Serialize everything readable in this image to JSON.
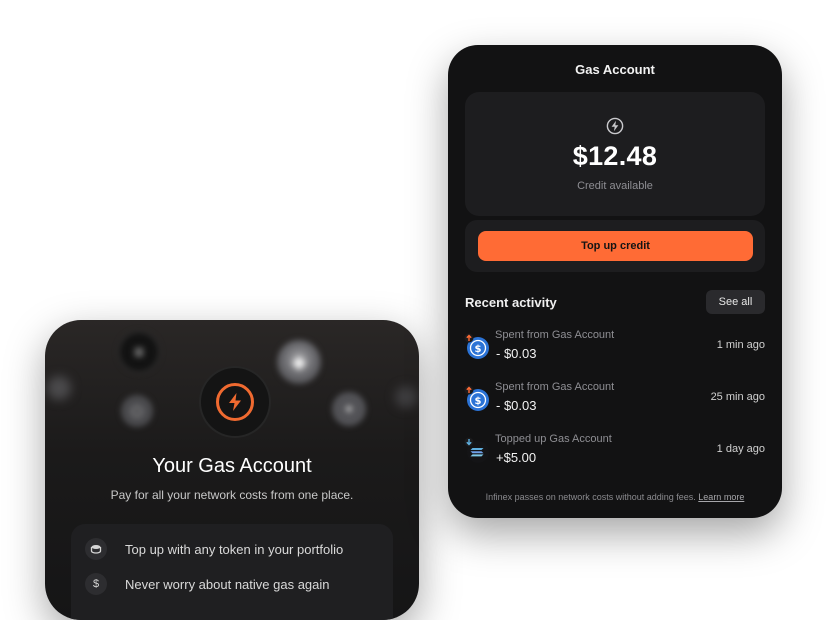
{
  "onboarding": {
    "title": "Your Gas Account",
    "subtitle": "Pay for all your network costs from one place.",
    "features": [
      {
        "icon": "coins-icon",
        "text": "Top up with any token in your portfolio"
      },
      {
        "icon": "dollar-icon",
        "text": "Never worry about native gas again"
      }
    ],
    "accent_color": "#f06a30"
  },
  "gas_account": {
    "header_title": "Gas Account",
    "balance": "$12.48",
    "balance_label": "Credit available",
    "topup_label": "Top up credit",
    "accent_color": "#ff6b35",
    "recent_title": "Recent activity",
    "see_all_label": "See all",
    "activity": [
      {
        "type": "spent",
        "icon": "usdc-spent-icon",
        "title": "Spent from Gas Account",
        "amount": "- $0.03",
        "time": "1 min ago"
      },
      {
        "type": "spent",
        "icon": "usdc-spent-icon",
        "title": "Spent from Gas Account",
        "amount": "- $0.03",
        "time": "25 min ago"
      },
      {
        "type": "topped_up",
        "icon": "sol-topup-icon",
        "title": "Topped up Gas Account",
        "amount": "+$5.00",
        "time": "1 day ago"
      }
    ],
    "footer_text": "Infinex passes on network costs without adding fees.",
    "footer_link": "Learn more"
  }
}
